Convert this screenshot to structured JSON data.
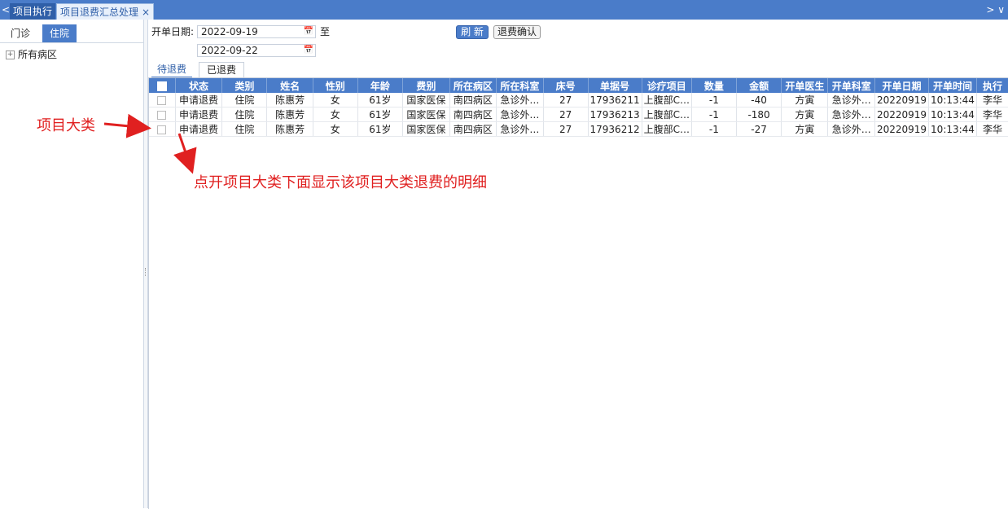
{
  "nav": {
    "left_arrow": "<",
    "right_arrows": "> ∨"
  },
  "tabs": [
    {
      "label": "项目执行"
    },
    {
      "label": "项目退费汇总处理",
      "close": "×"
    }
  ],
  "left": {
    "segments": [
      "门诊",
      "住院"
    ],
    "active_segment": "住院",
    "tree_root": "所有病区"
  },
  "filters": {
    "date_label": "开单日期:",
    "start_date": "2022-09-19",
    "to_label": "至",
    "end_date": "2022-09-22",
    "refresh_label": "刷 新",
    "confirm_label": "退费确认"
  },
  "subtabs": [
    "待退费",
    "已退费"
  ],
  "table": {
    "columns": [
      "状态",
      "类别",
      "姓名",
      "性别",
      "年龄",
      "费别",
      "所在病区",
      "所在科室",
      "床号",
      "单据号",
      "诊疗项目",
      "数量",
      "金额",
      "开单医生",
      "开单科室",
      "开单日期",
      "开单时间",
      "执行"
    ],
    "rows": [
      [
        "申请退费",
        "住院",
        "陈惠芳",
        "女",
        "61岁",
        "国家医保",
        "南四病区",
        "急诊外…",
        "27",
        "17936211",
        "上腹部C…",
        "-1",
        "-40",
        "方寅",
        "急诊外…",
        "20220919",
        "10:13:44",
        "李华"
      ],
      [
        "申请退费",
        "住院",
        "陈惠芳",
        "女",
        "61岁",
        "国家医保",
        "南四病区",
        "急诊外…",
        "27",
        "17936213",
        "上腹部C…",
        "-1",
        "-180",
        "方寅",
        "急诊外…",
        "20220919",
        "10:13:44",
        "李华"
      ],
      [
        "申请退费",
        "住院",
        "陈惠芳",
        "女",
        "61岁",
        "国家医保",
        "南四病区",
        "急诊外…",
        "27",
        "17936212",
        "上腹部C…",
        "-1",
        "-27",
        "方寅",
        "急诊外…",
        "20220919",
        "10:13:44",
        "李华"
      ]
    ]
  },
  "annotations": {
    "label1": "项目大类",
    "label2": "点开项目大类下面显示该项目大类退费的明细"
  },
  "colors": {
    "accent": "#4a7cc9",
    "annotation": "#e02020"
  }
}
